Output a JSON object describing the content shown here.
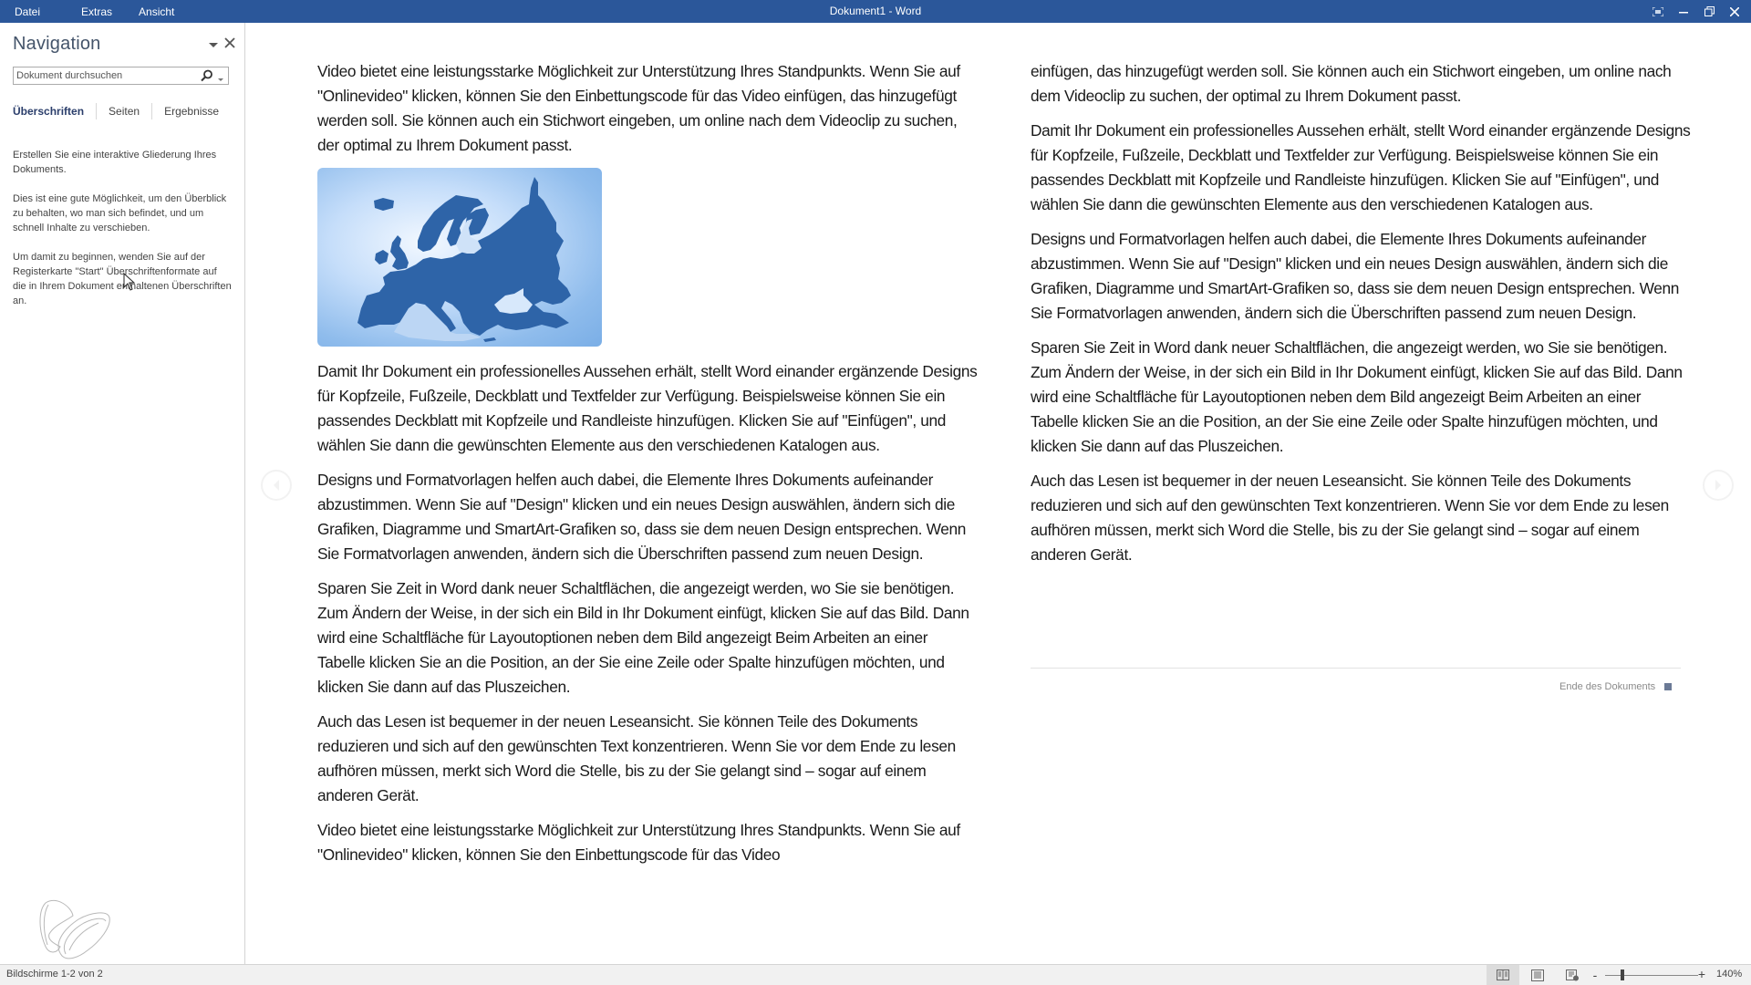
{
  "window": {
    "title": "Dokument1 - Word",
    "menu": [
      "Datei",
      "Extras",
      "Ansicht"
    ],
    "controls": [
      "focus-mode",
      "minimize",
      "restore",
      "close"
    ]
  },
  "navigation": {
    "title": "Navigation",
    "search_placeholder": "Dokument durchsuchen",
    "tabs": [
      {
        "label": "Überschriften",
        "active": true
      },
      {
        "label": "Seiten",
        "active": false
      },
      {
        "label": "Ergebnisse",
        "active": false
      }
    ],
    "help_paragraphs": [
      "Erstellen Sie eine interaktive Gliederung Ihres Dokuments.",
      "Dies ist eine gute Möglichkeit, um den Überblick zu behalten, wo man sich befindet, und um schnell Inhalte zu verschieben.",
      "Um damit zu beginnen, wenden Sie auf der Registerkarte \"Start\" Überschriftenformate auf die in Ihrem Dokument enthaltenen Überschriften an."
    ]
  },
  "document": {
    "column1": [
      "Video bietet eine leistungsstarke Möglichkeit zur Unterstützung Ihres Standpunkts. Wenn Sie auf \"Onlinevideo\" klicken, können Sie den Einbettungscode für das Video einfügen, das hinzugefügt werden soll. Sie können auch ein Stichwort eingeben, um online nach dem Videoclip zu suchen, der optimal zu Ihrem Dokument passt.",
      "Damit Ihr Dokument ein professionelles Aussehen erhält, stellt Word einander ergän­zende Designs für Kopfzeile, Fußzeile, Deckblatt und Textfelder zur Verfügung. Bei­spielsweise können Sie ein passendes Deckblatt mit Kopfzeile und Randleiste hinzu­fügen. Klicken Sie auf \"Einfügen\", und wählen Sie dann die gewünschten Elemente aus den verschiedenen Katalogen aus.",
      "Designs und Formatvorlagen helfen auch dabei, die Elemente Ihres Dokuments aufei­nander abzustimmen. Wenn Sie auf \"Design\" klicken und ein neues Design auswäh­len, ändern sich die Grafiken, Diagramme und SmartArt-Grafiken so, dass sie dem neuen Design entsprechen. Wenn Sie Formatvorlagen anwenden, ändern sich die Überschriften passend zum neuen Design.",
      "Sparen Sie Zeit in Word dank neuer Schaltflächen, die angezeigt werden, wo Sie sie benötigen. Zum Ändern der Weise, in der sich ein Bild in Ihr Dokument einfügt, kli­cken Sie auf das Bild. Dann wird eine Schaltfläche für Layoutoptionen neben dem Bild angezeigt Beim Arbeiten an einer Tabelle klicken Sie an die Position, an der Sie eine Zeile oder Spalte hinzufügen möchten, und klicken Sie dann auf das Pluszeichen.",
      "Auch das Lesen ist bequemer in der neuen Leseansicht. Sie können Teile des Doku­ments reduzieren und sich auf den gewünschten Text konzentrieren. Wenn Sie vor dem Ende zu lesen aufhören müssen, merkt sich Word die Stelle, bis zu der Sie ge­langt sind – sogar auf einem anderen Gerät.",
      "Video bietet eine leistungsstarke Möglichkeit zur Unterstützung Ihres Standpunkts. Wenn Sie auf \"Onlinevideo\" klicken, können Sie den Einbettungscode für das Video"
    ],
    "image_alt": "Karte von Europa",
    "column2": [
      "einfügen, das hinzugefügt werden soll. Sie können auch ein Stichwort eingeben, um online nach dem Videoclip zu suchen, der optimal zu Ihrem Dokument passt.",
      "Damit Ihr Dokument ein professionelles Aussehen erhält, stellt Word einander ergän­zende Designs für Kopfzeile, Fußzeile, Deckblatt und Textfelder zur Verfügung. Bei­spielsweise können Sie ein passendes Deckblatt mit Kopfzeile und Randleiste hinzu­fügen. Klicken Sie auf \"Einfügen\", und wählen Sie dann die gewünschten Elemente aus den verschiedenen Katalogen aus.",
      "Designs und Formatvorlagen helfen auch dabei, die Elemente Ihres Dokuments aufei­nander abzustimmen. Wenn Sie auf \"Design\" klicken und ein neues Design auswäh­len, ändern sich die Grafiken, Diagramme und SmartArt-Grafiken so, dass sie dem neuen Design entsprechen. Wenn Sie Formatvorlagen anwenden, ändern sich die Überschriften passend zum neuen Design.",
      "Sparen Sie Zeit in Word dank neuer Schaltflächen, die angezeigt werden, wo Sie sie benötigen. Zum Ändern der Weise, in der sich ein Bild in Ihr Dokument einfügt, kli­cken Sie auf das Bild. Dann wird eine Schaltfläche für Layoutoptionen neben dem Bild angezeigt Beim Arbeiten an einer Tabelle klicken Sie an die Position, an der Sie eine Zeile oder Spalte hinzufügen möchten, und klicken Sie dann auf das Pluszeichen.",
      "Auch das Lesen ist bequemer in der neuen Leseansicht. Sie können Teile des Doku­ments reduzieren und sich auf den gewünschten Text konzentrieren. Wenn Sie vor dem Ende zu lesen aufhören müssen, merkt sich Word die Stelle, bis zu der Sie ge­langt sind – sogar auf einem anderen Gerät."
    ],
    "end_label": "Ende des Dokuments"
  },
  "statusbar": {
    "screens": "Bildschirme 1-2 von 2",
    "view_modes": [
      "read-mode",
      "print-layout",
      "web-layout"
    ],
    "active_view": "read-mode",
    "zoom_minus": "-",
    "zoom_plus": "+",
    "zoom_level": "140%",
    "zoom_percent": 140
  },
  "colors": {
    "titlebar": "#2b579a",
    "nav_title": "#44546a",
    "active_tab": "#2b3e6b",
    "map_land": "#2e64a8"
  }
}
